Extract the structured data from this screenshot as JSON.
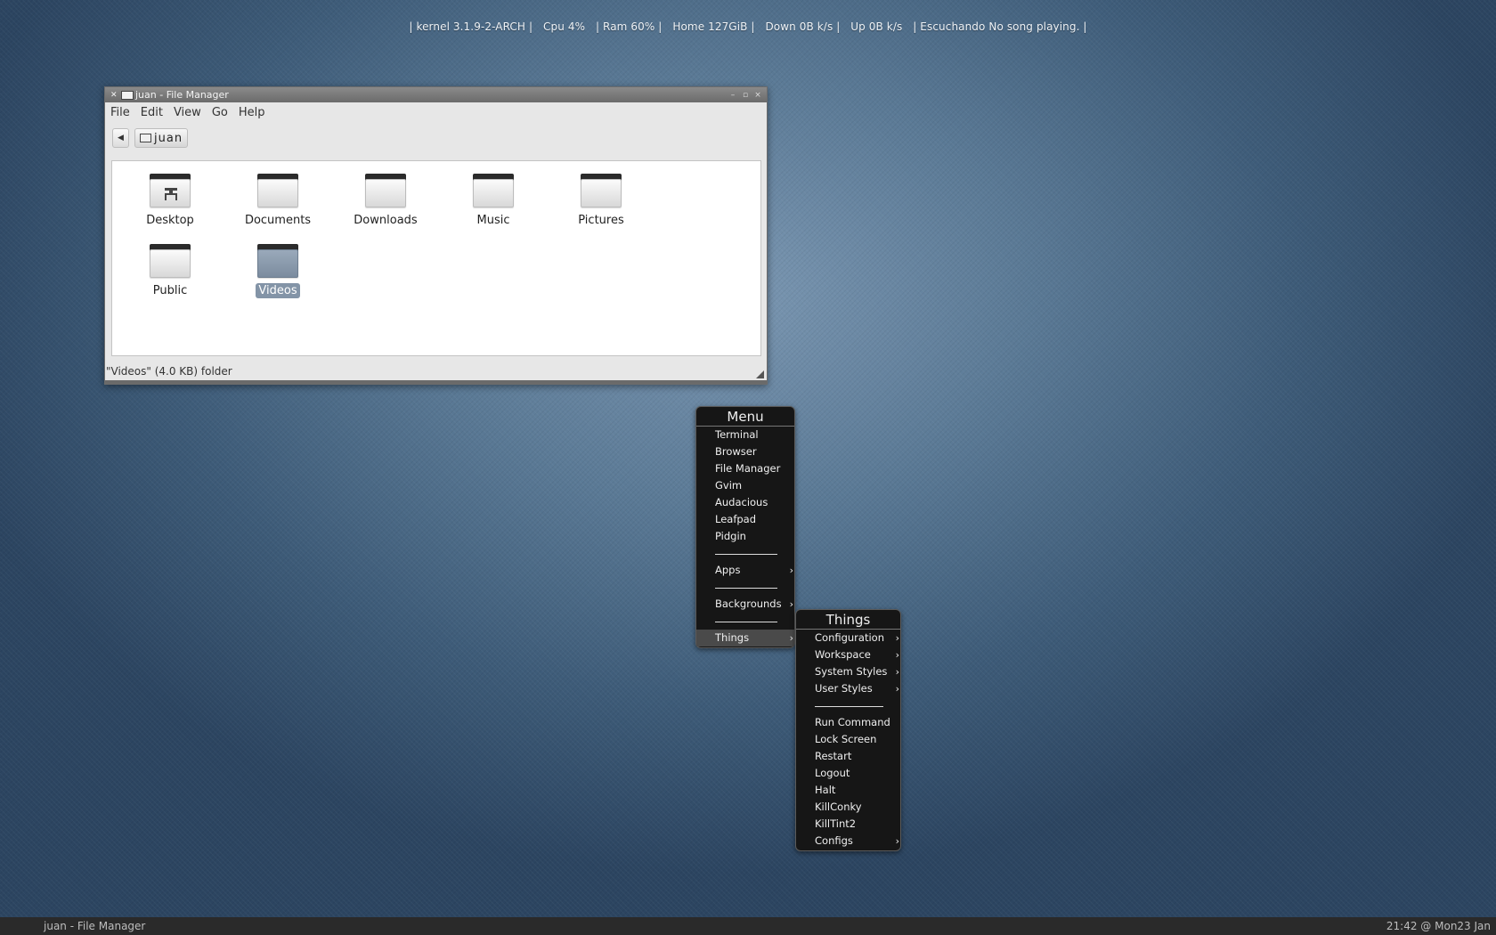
{
  "conky": {
    "kernel": "|   kernel 3.1.9-2-ARCH   |",
    "cpu": "Cpu 4%",
    "ram": "|   Ram 60%   |",
    "home": "Home 127GiB   |",
    "down": "Down 0B  k/s   |",
    "up": "Up 0B  k/s",
    "listening": "|  Escuchando  No song playing.  |"
  },
  "file_manager": {
    "title": "juan - File Manager",
    "menu": [
      "File",
      "Edit",
      "View",
      "Go",
      "Help"
    ],
    "path": "juan",
    "items": [
      {
        "label": "Desktop",
        "icon": "desktop-folder-icon"
      },
      {
        "label": "Documents",
        "icon": "folder-icon"
      },
      {
        "label": "Downloads",
        "icon": "folder-icon"
      },
      {
        "label": "Music",
        "icon": "folder-icon"
      },
      {
        "label": "Pictures",
        "icon": "folder-icon"
      },
      {
        "label": "Public",
        "icon": "folder-icon"
      },
      {
        "label": "Videos",
        "icon": "folder-icon",
        "selected": true
      }
    ],
    "status": "\"Videos\" (4.0 KB) folder"
  },
  "root_menu": {
    "title": "Menu",
    "items": [
      "Terminal",
      "Browser",
      "File Manager",
      "Gvim",
      "Audacious",
      "Leafpad",
      "Pidgin"
    ],
    "apps": "Apps",
    "backgrounds": "Backgrounds",
    "things": "Things"
  },
  "things_menu": {
    "title": "Things",
    "submenus": [
      "Configuration",
      "Workspace",
      "System Styles",
      "User Styles"
    ],
    "items": [
      "Run Command",
      "Lock Screen",
      "Restart",
      "Logout",
      "Halt",
      "KillConky",
      "KillTint2"
    ],
    "configs": "Configs"
  },
  "panel": {
    "task": "juan - File Manager",
    "clock": "21:42 @ Mon23 Jan"
  },
  "colors": {
    "desktop_bg": "#4f6e8c",
    "menu_bg": "#161616",
    "selection": "#8394a7"
  }
}
